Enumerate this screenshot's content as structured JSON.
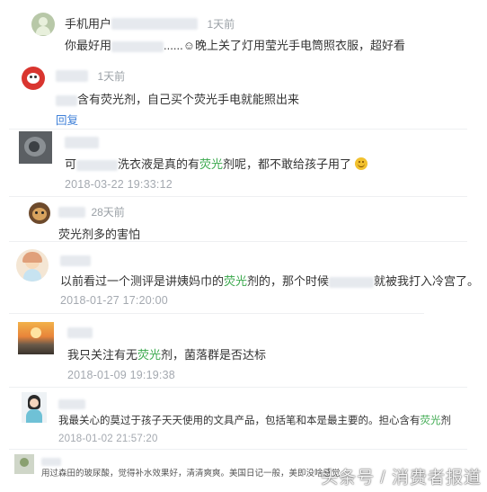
{
  "comments": [
    {
      "name": "手机用户",
      "time": "1天前",
      "text_start": "你最好用",
      "text_mid": "......",
      "smiley": "☺",
      "text_end": "晚上关了灯用莹光手电筒照衣服，超好看"
    },
    {
      "time": "1天前",
      "text": "含有荧光剂，自己买个荧光手电就能照出来",
      "reply": "回复"
    },
    {
      "text_start": "可",
      "text_mid": "洗衣液是真的有",
      "highlight": "荧光",
      "text_end": "剂呢，都不敢给孩子用了",
      "date": "2018-03-22 19:33:12"
    },
    {
      "time": "28天前",
      "text": "荧光剂多的害怕"
    },
    {
      "text_start": "以前看过一个测评是讲姨妈巾的",
      "highlight": "荧光",
      "text_mid": "剂的，那个时候",
      "text_end": "就被我打入冷宫了。",
      "date": "2018-01-27 17:20:00"
    },
    {
      "text_start": "我只关注有无",
      "highlight": "荧光",
      "text_end": "剂，菌落群是否达标",
      "date": "2018-01-09 19:19:38"
    },
    {
      "text_start": "我最关心的莫过于孩子天天使用的文具产品，包括笔和本是最主要的。担心含有",
      "highlight": "荧光",
      "text_end": "剂",
      "date": "2018-01-02 21:57:20"
    },
    {
      "text": "用过森田的玻尿酸，觉得补水效果好，清清爽爽。美国日记一般，美即没啥感觉"
    }
  ],
  "watermark": "头条号 / 消费者报道",
  "colors": {
    "highlight": "#3aa84c",
    "link": "#3d7fd8",
    "date": "#a4a9b0"
  }
}
